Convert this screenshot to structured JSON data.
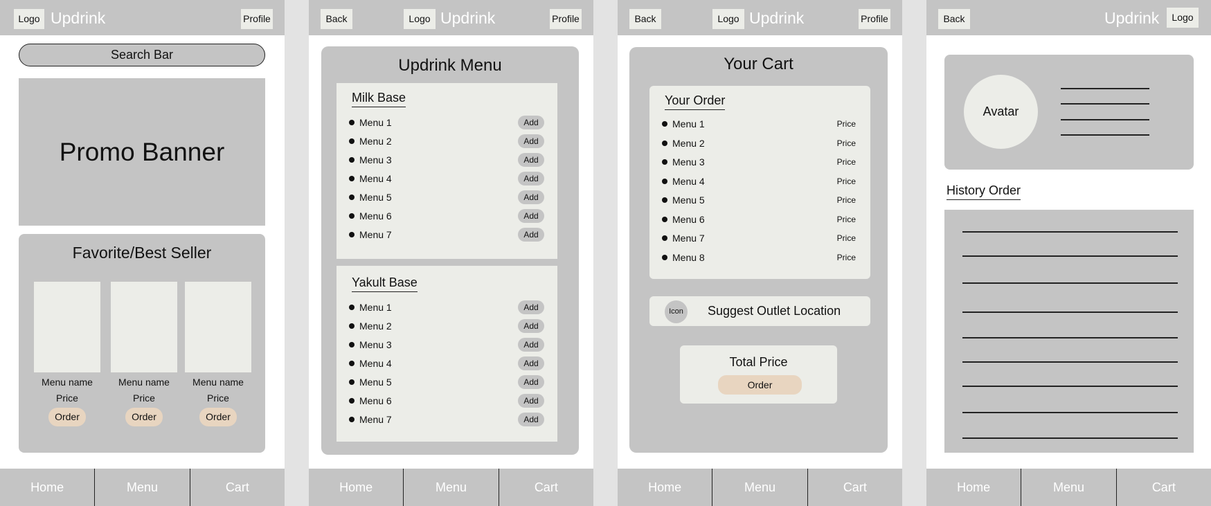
{
  "brand": "Updrink",
  "header": {
    "logo": "Logo",
    "profile": "Profile",
    "back": "Back"
  },
  "nav": [
    "Home",
    "Menu",
    "Cart"
  ],
  "home": {
    "search": "Search Bar",
    "promo": "Promo Banner",
    "favorites_title": "Favorite/Best Seller",
    "cards": [
      {
        "name": "Menu name",
        "price": "Price",
        "order": "Order"
      },
      {
        "name": "Menu name",
        "price": "Price",
        "order": "Order"
      },
      {
        "name": "Menu name",
        "price": "Price",
        "order": "Order"
      }
    ]
  },
  "menu": {
    "title": "Updrink Menu",
    "add_label": "Add",
    "sections": [
      {
        "title": "Milk Base",
        "items": [
          "Menu 1",
          "Menu 2",
          "Menu 3",
          "Menu 4",
          "Menu 5",
          "Menu 6",
          "Menu 7"
        ]
      },
      {
        "title": "Yakult Base",
        "items": [
          "Menu 1",
          "Menu 2",
          "Menu 3",
          "Menu 4",
          "Menu 5",
          "Menu 6",
          "Menu 7"
        ]
      }
    ]
  },
  "cart": {
    "title": "Your Cart",
    "order_title": "Your Order",
    "items": [
      "Menu 1",
      "Menu 2",
      "Menu 3",
      "Menu 4",
      "Menu 5",
      "Menu 6",
      "Menu 7",
      "Menu 8"
    ],
    "price_label": "Price",
    "outlet_icon": "Icon",
    "outlet_label": "Suggest Outlet Location",
    "total_label": "Total Price",
    "order_button": "Order"
  },
  "profile": {
    "avatar": "Avatar",
    "history_title": "History Order"
  },
  "colors": {
    "panel": "#c4c4c4",
    "card": "#ecede8",
    "accent": "#e8d5c0",
    "background": "#e3e3e3"
  }
}
